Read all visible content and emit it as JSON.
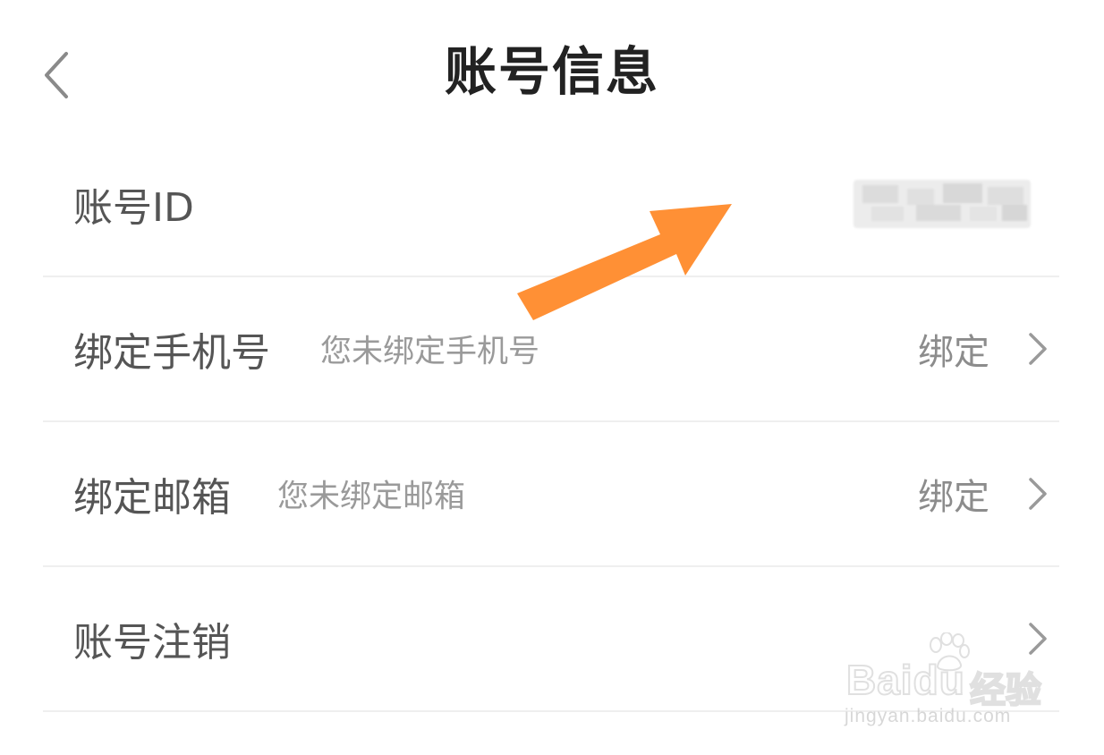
{
  "header": {
    "title": "账号信息",
    "back_icon": "chevron-left-icon"
  },
  "rows": [
    {
      "label": "账号ID",
      "sub": "",
      "action": "",
      "value_obscured": true
    },
    {
      "label": "绑定手机号",
      "sub": "您未绑定手机号",
      "action": "绑定"
    },
    {
      "label": "绑定邮箱",
      "sub": "您未绑定邮箱",
      "action": "绑定"
    },
    {
      "label": "账号注销",
      "sub": "",
      "action": ""
    }
  ],
  "overlay": {
    "arrow_color": "#FF9035"
  },
  "watermark": {
    "brand": "Bai",
    "brand_tail": "du",
    "suffix": "经验",
    "url": "jingyan.baidu.com"
  },
  "colors": {
    "title": "#222222",
    "label": "#555555",
    "sub": "#9A9A9A",
    "action": "#8C8C8C",
    "divider": "#EFEFEF"
  }
}
